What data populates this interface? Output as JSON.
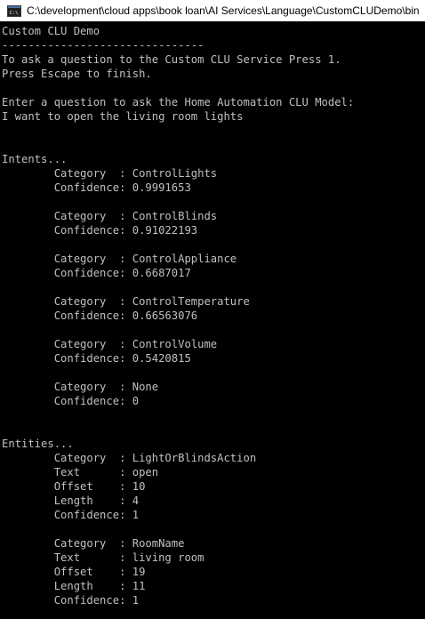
{
  "window": {
    "title": "C:\\development\\cloud apps\\book loan\\AI Services\\Language\\CustomCLUDemo\\bin",
    "icon": "console-app-icon"
  },
  "console": {
    "lines": [
      "Custom CLU Demo",
      "-------------------------------",
      "To ask a question to the Custom CLU Service Press 1.",
      "Press Escape to finish.",
      "",
      "Enter a question to ask the Home Automation CLU Model:",
      "I want to open the living room lights",
      "",
      "",
      "Intents...",
      "        Category  : ControlLights",
      "        Confidence: 0.9991653",
      "",
      "        Category  : ControlBlinds",
      "        Confidence: 0.91022193",
      "",
      "        Category  : ControlAppliance",
      "        Confidence: 0.6687017",
      "",
      "        Category  : ControlTemperature",
      "        Confidence: 0.66563076",
      "",
      "        Category  : ControlVolume",
      "        Confidence: 0.5420815",
      "",
      "        Category  : None",
      "        Confidence: 0",
      "",
      "",
      "Entities...",
      "        Category  : LightOrBlindsAction",
      "        Text      : open",
      "        Offset    : 10",
      "        Length    : 4",
      "        Confidence: 1",
      "",
      "        Category  : RoomName",
      "        Text      : living room",
      "        Offset    : 19",
      "        Length    : 11",
      "        Confidence: 1"
    ]
  }
}
